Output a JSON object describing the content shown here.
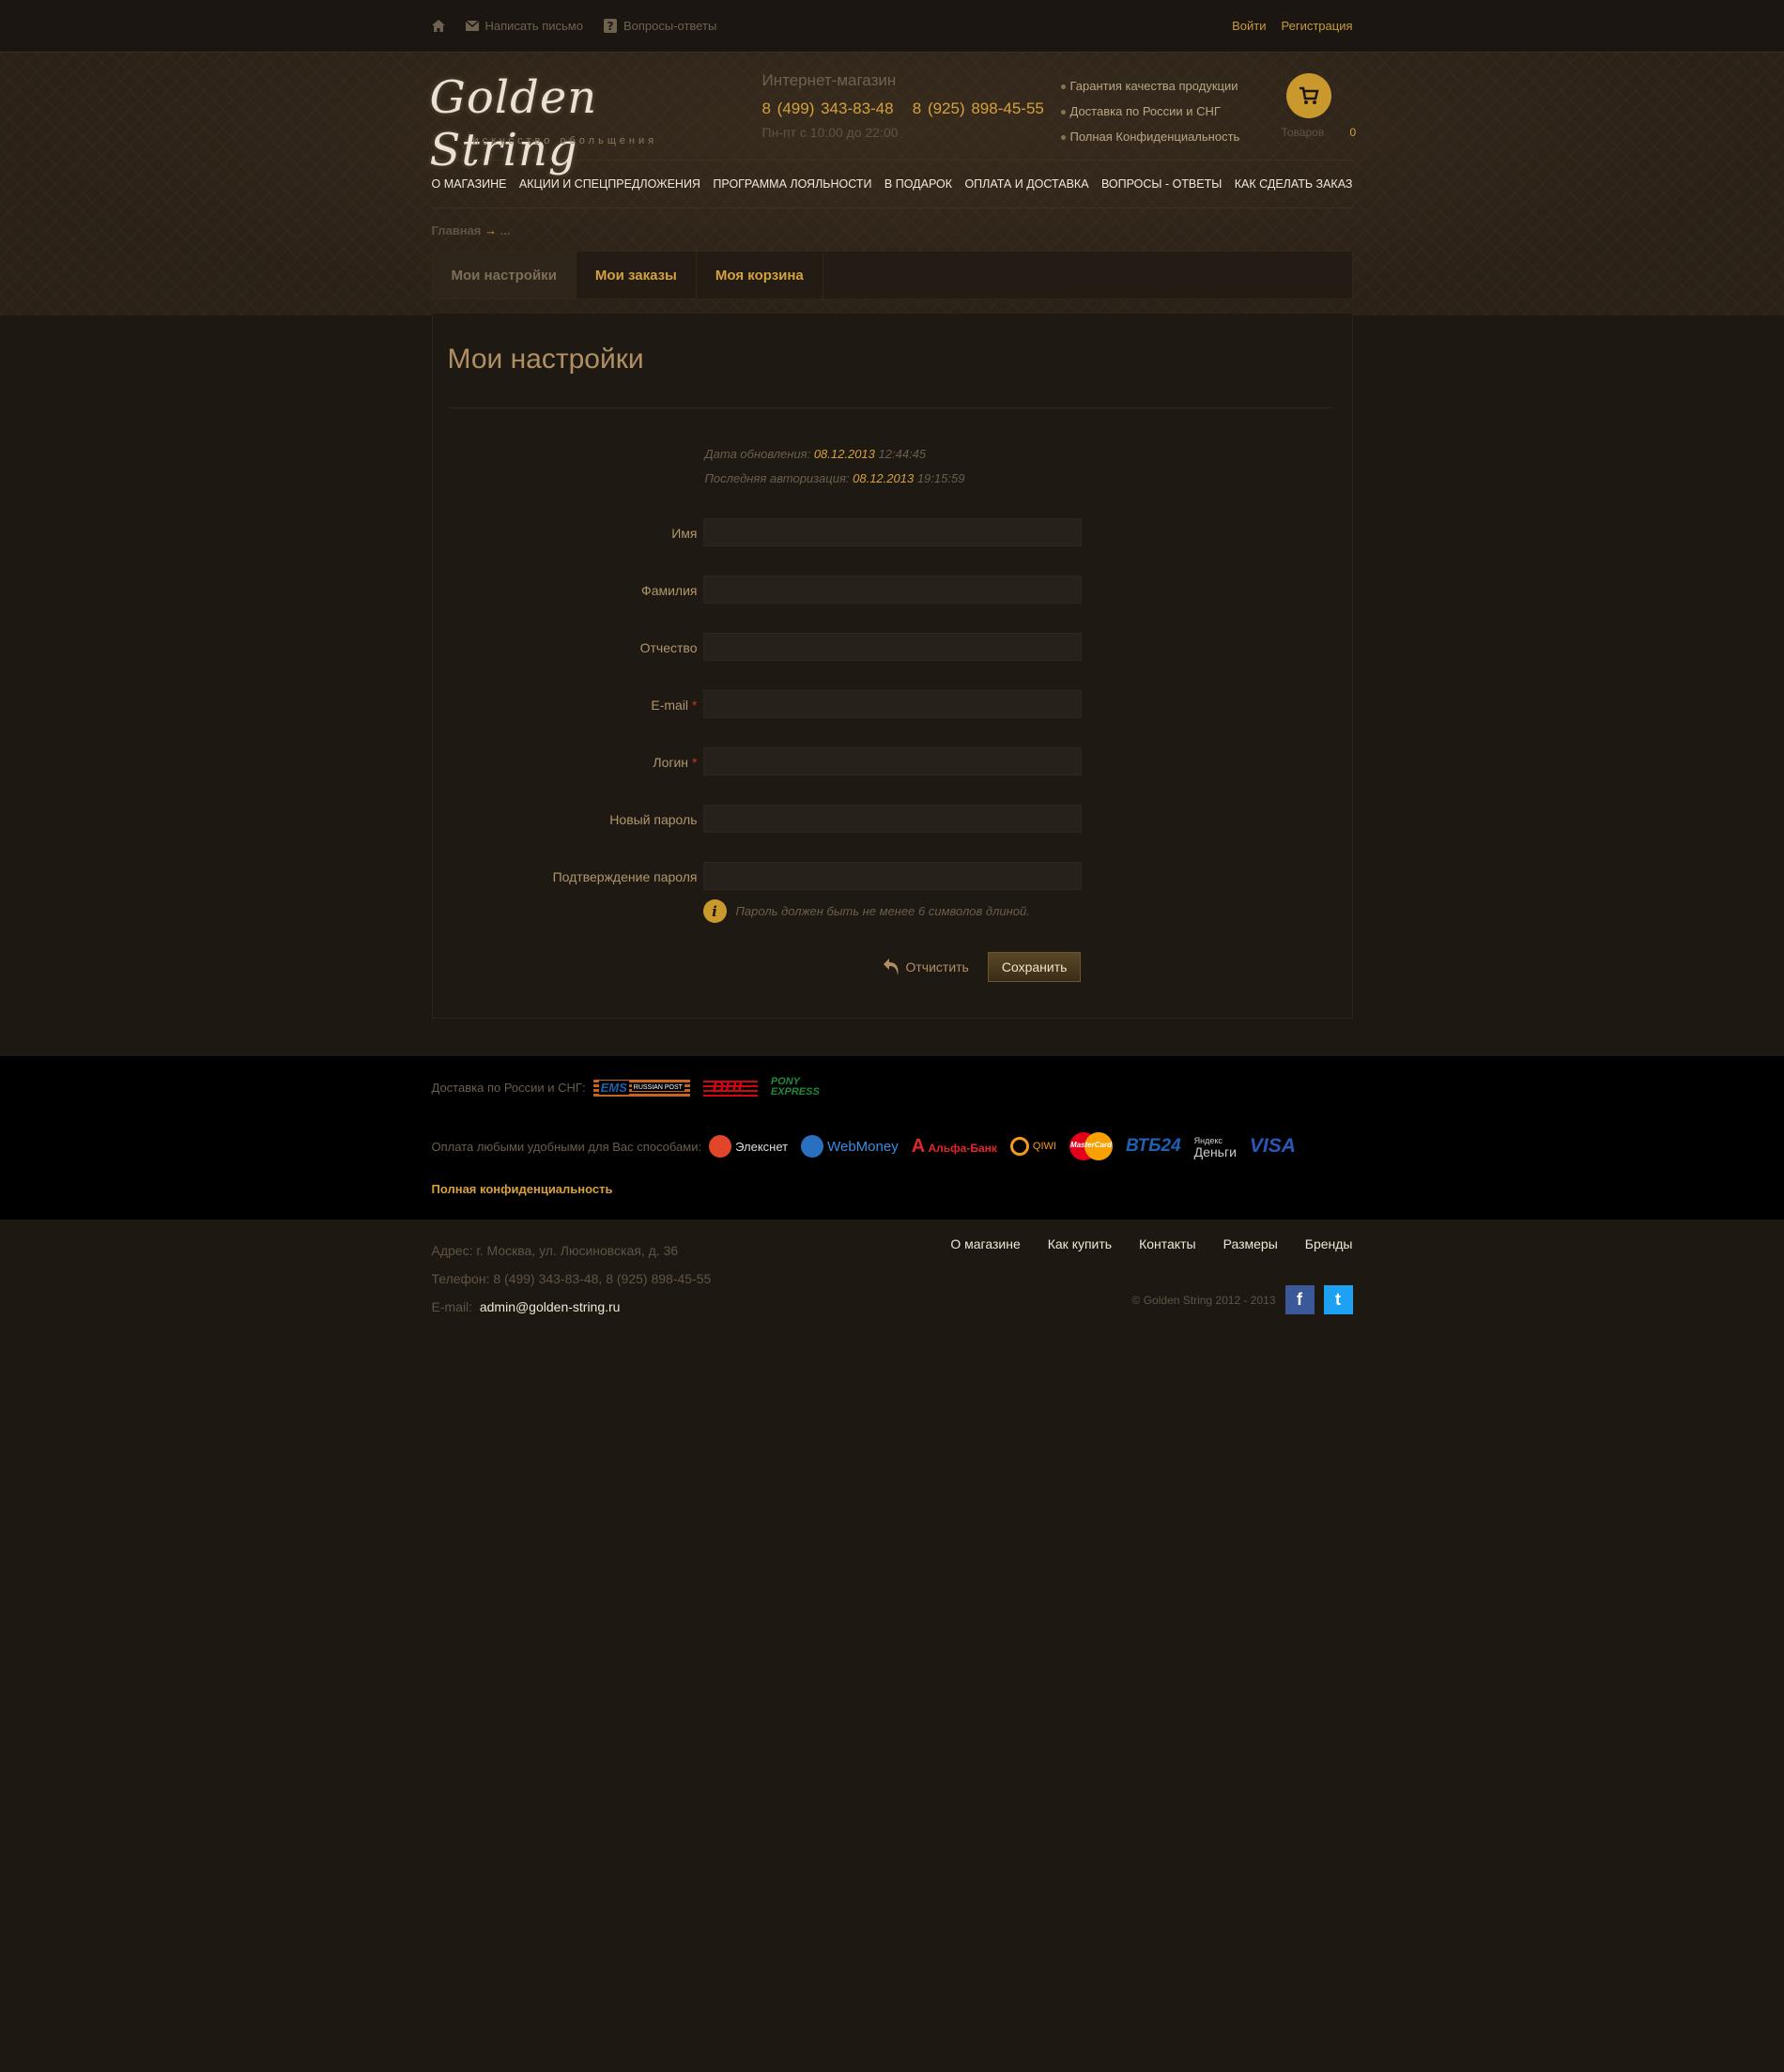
{
  "topbar": {
    "write_letter": "Написать письмо",
    "faq": "Вопросы-ответы",
    "login": "Войти",
    "register": "Регистрация"
  },
  "header": {
    "logo_text": "Golden String",
    "logo_tagline": "искусство обольщения",
    "shop_label": "Интернет-магазин",
    "phone1": "8 (499) 343-83-48",
    "phone2": "8 (925) 898-45-55",
    "hours": "Пн-пт с 10:00 до 22:00",
    "features": [
      "Гарантия качества продукции",
      "Доставка по России и СНГ",
      "Полная Конфиденциальность"
    ],
    "cart_label": "Товаров",
    "cart_count": "0"
  },
  "nav": [
    "О магазине",
    "Акции и спецпредложения",
    "Программа лояльности",
    "В подарок",
    "Оплата и доставка",
    "Вопросы - ответы",
    "Как сделать заказ"
  ],
  "breadcrumb": {
    "home": "Главная",
    "arrow": "→",
    "current": "..."
  },
  "tabs": [
    "Мои настройки",
    "Мои заказы",
    "Моя корзина"
  ],
  "page": {
    "title": "Мои настройки",
    "updated_label": "Дата обновления:",
    "updated_date": "08.12.2013",
    "updated_time": "12:44:45",
    "lastauth_label": "Последняя авторизация:",
    "lastauth_date": "08.12.2013",
    "lastauth_time": "19:15:59"
  },
  "form": {
    "fields": [
      {
        "label": "Имя",
        "required": false,
        "value": ""
      },
      {
        "label": "Фамилия",
        "required": false,
        "value": ""
      },
      {
        "label": "Отчество",
        "required": false,
        "value": ""
      },
      {
        "label": "E-mail",
        "required": true,
        "value": ""
      },
      {
        "label": "Логин",
        "required": true,
        "value": ""
      },
      {
        "label": "Новый пароль",
        "required": false,
        "value": ""
      },
      {
        "label": "Подтверждение пароля",
        "required": false,
        "value": ""
      }
    ],
    "required_mark": "*",
    "hint_icon": "i",
    "hint": "Пароль должен быть не менее 6 символов длиной.",
    "cancel": "Отчистить",
    "save": "Сохранить"
  },
  "delivery": {
    "label": "Доставка по России и СНГ:",
    "carriers": [
      "EMS",
      "RUSSIAN POST",
      "DHL",
      "PONY",
      "EXPRESS"
    ]
  },
  "payment": {
    "label": "Оплата любыми удобными для Вас способами:",
    "methods": [
      "Элекснет",
      "WebMoney",
      "Альфа-Банк",
      "QIWI",
      "MasterCard",
      "ВТБ24",
      "Яндекс",
      "Деньги",
      "VISA"
    ]
  },
  "privacy": "Полная конфиденциальность",
  "footer": {
    "address": "Адрес: г. Москва, ул. Люсиновская, д. 36",
    "phone": "Телефон:  8 (499) 343-83-48, 8 (925) 898-45-55",
    "email_label": "E-mail:",
    "email": "admin@golden-string.ru",
    "links": [
      "О магазине",
      "Как купить",
      "Контакты",
      "Размеры",
      "Бренды"
    ],
    "copyright": "© Golden String  2012 - 2013",
    "facebook": "f",
    "twitter": "t"
  },
  "colors": {
    "accent": "#d5a13e",
    "background": "#1e1813",
    "strip": "#000000"
  }
}
